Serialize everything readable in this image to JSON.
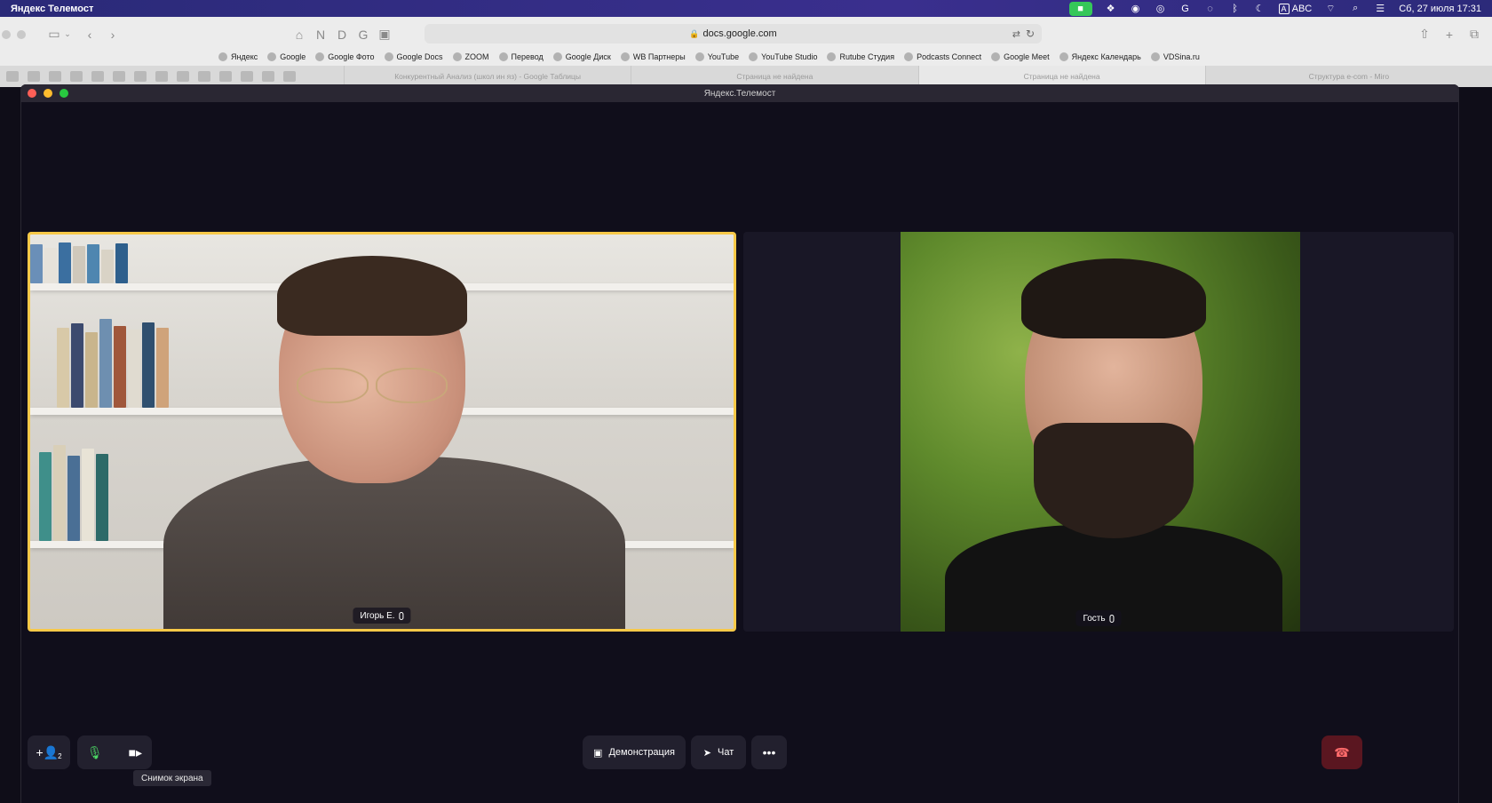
{
  "menubar": {
    "app_name": "Яндекс Телемост",
    "layout_label": "ABC",
    "datetime": "Сб, 27 июля  17:31",
    "icons": [
      "facetime-icon",
      "dropbox-icon",
      "zoom-icon",
      "chrome-icon",
      "grammarly-icon",
      "vpn-icon",
      "bluetooth-icon",
      "moon-icon",
      "input-source-icon",
      "wifi-icon",
      "spotlight-icon",
      "control-center-icon"
    ]
  },
  "browser": {
    "url": "docs.google.com",
    "bookmarks": [
      "Яндекс",
      "Google",
      "Google Фото",
      "Google Docs",
      "ZOOM",
      "Перевод",
      "Google Диск",
      "WB Партнеры",
      "YouTube",
      "YouTube Studio",
      "Rutube Студия",
      "Podcasts Connect",
      "Google Meet",
      "Яндекс Календарь",
      "VDSina.ru"
    ],
    "tabs": [
      "Конкурентный Анализ (школ ин яз) - Google Таблицы",
      "Страница не найдена",
      "Страница не найдена",
      "Структура e-com - Miro"
    ]
  },
  "window": {
    "title": "Яндекс.Телемост"
  },
  "participants": [
    {
      "name": "Игорь Е.",
      "active_speaker": true
    },
    {
      "name": "Гость",
      "active_speaker": false
    }
  ],
  "controls": {
    "add_badge": "2",
    "demo_label": "Демонстрация",
    "chat_label": "Чат",
    "tooltip": "Снимок экрана"
  },
  "colors": {
    "active_speaker_border": "#f7c948",
    "end_call": "#5a1620",
    "mic_on": "#4cd964"
  }
}
